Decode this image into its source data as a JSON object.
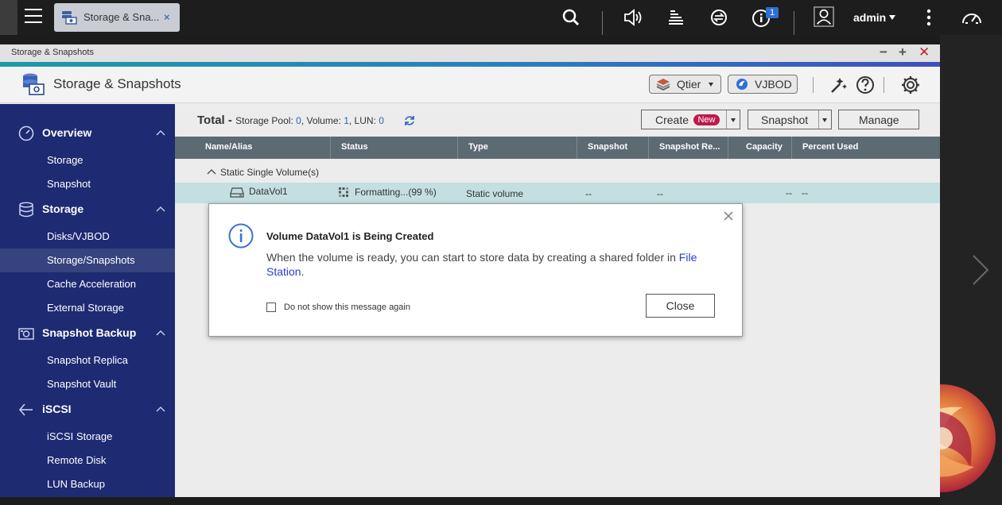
{
  "taskbar": {
    "app_tab_label": "Storage & Sna...",
    "app_tab_close": "×",
    "notification_count": "1",
    "user_name": "admin"
  },
  "window": {
    "title": "Storage & Snapshots",
    "minimize": "−",
    "maximize": "+",
    "close": "✕"
  },
  "header": {
    "app_title": "Storage & Snapshots",
    "qtier_label": "Qtier",
    "vjbod_label": "VJBOD"
  },
  "sidebar": {
    "sections": [
      {
        "label": "Overview",
        "items": [
          "Storage",
          "Snapshot"
        ]
      },
      {
        "label": "Storage",
        "items": [
          "Disks/VJBOD",
          "Storage/Snapshots",
          "Cache Acceleration",
          "External Storage"
        ]
      },
      {
        "label": "Snapshot Backup",
        "items": [
          "Snapshot Replica",
          "Snapshot Vault"
        ]
      },
      {
        "label": "iSCSI",
        "items": [
          "iSCSI Storage",
          "Remote Disk",
          "LUN Backup"
        ]
      }
    ],
    "active_item": "Storage/Snapshots"
  },
  "toolbar": {
    "total_title": "Total",
    "total_sep": " - ",
    "pool_label": "Storage Pool: ",
    "pool_count": "0",
    "volume_label": ", Volume: ",
    "volume_count": "1",
    "lun_label": ", LUN: ",
    "lun_count": "0",
    "create_label": "Create",
    "new_badge": "New",
    "snapshot_label": "Snapshot",
    "manage_label": "Manage"
  },
  "table": {
    "columns": [
      "Name/Alias",
      "Status",
      "Type",
      "Snapshot",
      "Snapshot Re...",
      "Capacity",
      "Percent Used"
    ],
    "group_label": "Static Single Volume(s)",
    "row": {
      "name": "DataVol1",
      "status": "Formatting...(99 %)",
      "type": "Static volume",
      "snapshot": "--",
      "snapshot_replica": "--",
      "capacity": "--",
      "percent_used": "--"
    }
  },
  "dialog": {
    "title": "Volume DataVol1 is Being Created",
    "message": "When the volume is ready, you can start to store data by creating a shared folder in ",
    "link": "File Station",
    "message_end": ".",
    "checkbox_label": "Do not show this message again",
    "close_button": "Close"
  },
  "colors": {
    "sidebar_bg": "#1e2a72",
    "sidebar_active": "#36437f",
    "table_header": "#5c6a72",
    "selected_row": "#c3dfe0",
    "link": "#2a3fc7",
    "new_badge": "#c0184d",
    "accent_bar_start": "#1d9aa6"
  },
  "icons": {
    "taskbar": [
      "menu-icon",
      "search-icon",
      "volume-icon",
      "task-stack-icon",
      "sync-icon",
      "info-icon",
      "user-icon",
      "more-icon",
      "dashboard-icon"
    ],
    "header": [
      "diagnostic-icon",
      "help-icon",
      "settings-icon"
    ]
  }
}
